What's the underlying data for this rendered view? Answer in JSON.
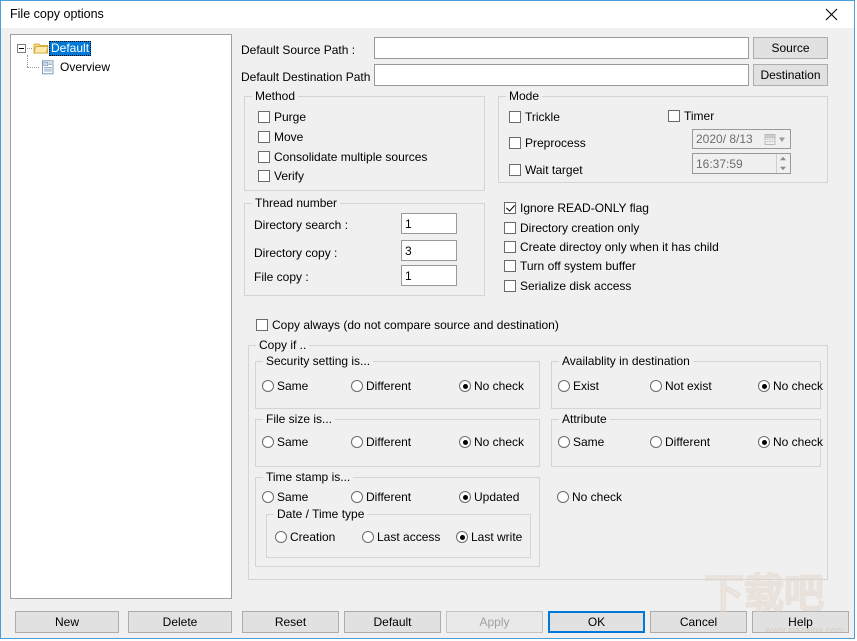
{
  "window": {
    "title": "File copy options",
    "close_icon": "close-icon"
  },
  "tree": {
    "root": {
      "label": "Default",
      "selected": true
    },
    "child": {
      "label": "Overview",
      "selected": false
    }
  },
  "paths": {
    "source_label": "Default Source Path :",
    "source_value": "",
    "source_button": "Source",
    "destination_label": "Default Destination Path :",
    "destination_value": "",
    "destination_button": "Destination"
  },
  "method": {
    "title": "Method",
    "items": [
      {
        "label": "Purge",
        "checked": false
      },
      {
        "label": "Move",
        "checked": false
      },
      {
        "label": "Consolidate multiple sources",
        "checked": false
      },
      {
        "label": "Verify",
        "checked": false
      }
    ]
  },
  "mode": {
    "title": "Mode",
    "items": [
      {
        "label": "Trickle",
        "checked": false
      },
      {
        "label": "Preprocess",
        "checked": false
      },
      {
        "label": "Wait target",
        "checked": false
      }
    ],
    "timer": {
      "label": "Timer",
      "checked": false
    },
    "date_value": "2020/  8/13",
    "time_value": "16:37:59"
  },
  "thread": {
    "title": "Thread number",
    "rows": [
      {
        "label": "Directory search :",
        "value": "1"
      },
      {
        "label": "Directory copy :",
        "value": "3"
      },
      {
        "label": "File copy :",
        "value": "1"
      }
    ]
  },
  "options": [
    {
      "label": "Ignore READ-ONLY flag",
      "checked": true
    },
    {
      "label": "Directory creation only",
      "checked": false
    },
    {
      "label": "Create directoy only when it has child",
      "checked": false
    },
    {
      "label": "Turn off system buffer",
      "checked": false
    },
    {
      "label": "Serialize disk access",
      "checked": false
    }
  ],
  "copy_always": {
    "label": "Copy always (do not compare source and destination)",
    "checked": false
  },
  "copy_if": {
    "title": "Copy if ..",
    "security": {
      "title": "Security setting is...",
      "options": [
        {
          "label": "Same",
          "checked": false
        },
        {
          "label": "Different",
          "checked": false
        },
        {
          "label": "No check",
          "checked": true
        }
      ]
    },
    "availability": {
      "title": "Availablity in destination",
      "options": [
        {
          "label": "Exist",
          "checked": false
        },
        {
          "label": "Not exist",
          "checked": false
        },
        {
          "label": "No check",
          "checked": true
        }
      ]
    },
    "filesize": {
      "title": "File size is...",
      "options": [
        {
          "label": "Same",
          "checked": false
        },
        {
          "label": "Different",
          "checked": false
        },
        {
          "label": "No check",
          "checked": true
        }
      ]
    },
    "attribute": {
      "title": "Attribute",
      "options": [
        {
          "label": "Same",
          "checked": false
        },
        {
          "label": "Different",
          "checked": false
        },
        {
          "label": "No check",
          "checked": true
        }
      ]
    },
    "timestamp": {
      "title": "Time stamp is...",
      "options": [
        {
          "label": "Same",
          "checked": false
        },
        {
          "label": "Different",
          "checked": false
        },
        {
          "label": "Updated",
          "checked": true
        },
        {
          "label": "No check",
          "checked": false
        }
      ],
      "datetime_type": {
        "title": "Date / Time type",
        "options": [
          {
            "label": "Creation",
            "checked": false
          },
          {
            "label": "Last access",
            "checked": false
          },
          {
            "label": "Last write",
            "checked": true
          }
        ]
      }
    }
  },
  "buttons": {
    "new": "New",
    "delete": "Delete",
    "reset": "Reset",
    "default": "Default",
    "apply": "Apply",
    "ok": "OK",
    "cancel": "Cancel",
    "help": "Help"
  },
  "watermark": {
    "cjk": "下载吧",
    "url": "www.xiazaiba.com"
  },
  "colors": {
    "accent": "#0078d7",
    "dialog_bg": "#f0f0f0",
    "selection": "#0078d7"
  }
}
